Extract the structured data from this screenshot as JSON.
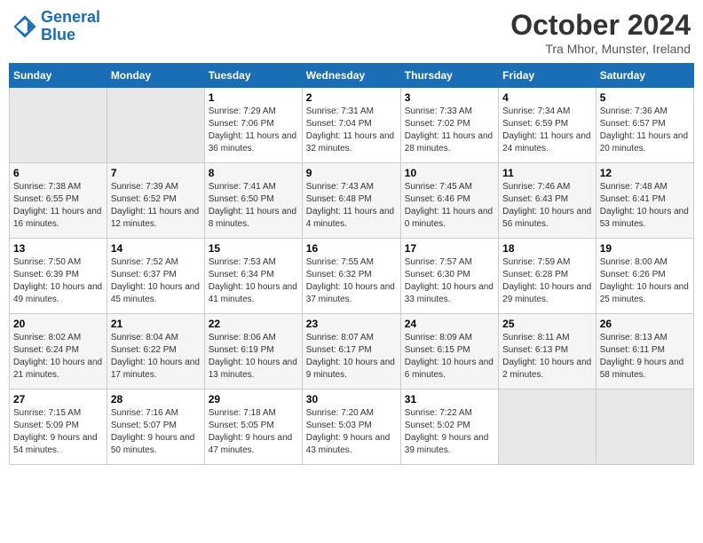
{
  "header": {
    "logo_line1": "General",
    "logo_line2": "Blue",
    "month": "October 2024",
    "location": "Tra Mhor, Munster, Ireland"
  },
  "days_of_week": [
    "Sunday",
    "Monday",
    "Tuesday",
    "Wednesday",
    "Thursday",
    "Friday",
    "Saturday"
  ],
  "weeks": [
    [
      {
        "num": "",
        "sunrise": "",
        "sunset": "",
        "daylight": ""
      },
      {
        "num": "",
        "sunrise": "",
        "sunset": "",
        "daylight": ""
      },
      {
        "num": "1",
        "sunrise": "Sunrise: 7:29 AM",
        "sunset": "Sunset: 7:06 PM",
        "daylight": "Daylight: 11 hours and 36 minutes."
      },
      {
        "num": "2",
        "sunrise": "Sunrise: 7:31 AM",
        "sunset": "Sunset: 7:04 PM",
        "daylight": "Daylight: 11 hours and 32 minutes."
      },
      {
        "num": "3",
        "sunrise": "Sunrise: 7:33 AM",
        "sunset": "Sunset: 7:02 PM",
        "daylight": "Daylight: 11 hours and 28 minutes."
      },
      {
        "num": "4",
        "sunrise": "Sunrise: 7:34 AM",
        "sunset": "Sunset: 6:59 PM",
        "daylight": "Daylight: 11 hours and 24 minutes."
      },
      {
        "num": "5",
        "sunrise": "Sunrise: 7:36 AM",
        "sunset": "Sunset: 6:57 PM",
        "daylight": "Daylight: 11 hours and 20 minutes."
      }
    ],
    [
      {
        "num": "6",
        "sunrise": "Sunrise: 7:38 AM",
        "sunset": "Sunset: 6:55 PM",
        "daylight": "Daylight: 11 hours and 16 minutes."
      },
      {
        "num": "7",
        "sunrise": "Sunrise: 7:39 AM",
        "sunset": "Sunset: 6:52 PM",
        "daylight": "Daylight: 11 hours and 12 minutes."
      },
      {
        "num": "8",
        "sunrise": "Sunrise: 7:41 AM",
        "sunset": "Sunset: 6:50 PM",
        "daylight": "Daylight: 11 hours and 8 minutes."
      },
      {
        "num": "9",
        "sunrise": "Sunrise: 7:43 AM",
        "sunset": "Sunset: 6:48 PM",
        "daylight": "Daylight: 11 hours and 4 minutes."
      },
      {
        "num": "10",
        "sunrise": "Sunrise: 7:45 AM",
        "sunset": "Sunset: 6:46 PM",
        "daylight": "Daylight: 11 hours and 0 minutes."
      },
      {
        "num": "11",
        "sunrise": "Sunrise: 7:46 AM",
        "sunset": "Sunset: 6:43 PM",
        "daylight": "Daylight: 10 hours and 56 minutes."
      },
      {
        "num": "12",
        "sunrise": "Sunrise: 7:48 AM",
        "sunset": "Sunset: 6:41 PM",
        "daylight": "Daylight: 10 hours and 53 minutes."
      }
    ],
    [
      {
        "num": "13",
        "sunrise": "Sunrise: 7:50 AM",
        "sunset": "Sunset: 6:39 PM",
        "daylight": "Daylight: 10 hours and 49 minutes."
      },
      {
        "num": "14",
        "sunrise": "Sunrise: 7:52 AM",
        "sunset": "Sunset: 6:37 PM",
        "daylight": "Daylight: 10 hours and 45 minutes."
      },
      {
        "num": "15",
        "sunrise": "Sunrise: 7:53 AM",
        "sunset": "Sunset: 6:34 PM",
        "daylight": "Daylight: 10 hours and 41 minutes."
      },
      {
        "num": "16",
        "sunrise": "Sunrise: 7:55 AM",
        "sunset": "Sunset: 6:32 PM",
        "daylight": "Daylight: 10 hours and 37 minutes."
      },
      {
        "num": "17",
        "sunrise": "Sunrise: 7:57 AM",
        "sunset": "Sunset: 6:30 PM",
        "daylight": "Daylight: 10 hours and 33 minutes."
      },
      {
        "num": "18",
        "sunrise": "Sunrise: 7:59 AM",
        "sunset": "Sunset: 6:28 PM",
        "daylight": "Daylight: 10 hours and 29 minutes."
      },
      {
        "num": "19",
        "sunrise": "Sunrise: 8:00 AM",
        "sunset": "Sunset: 6:26 PM",
        "daylight": "Daylight: 10 hours and 25 minutes."
      }
    ],
    [
      {
        "num": "20",
        "sunrise": "Sunrise: 8:02 AM",
        "sunset": "Sunset: 6:24 PM",
        "daylight": "Daylight: 10 hours and 21 minutes."
      },
      {
        "num": "21",
        "sunrise": "Sunrise: 8:04 AM",
        "sunset": "Sunset: 6:22 PM",
        "daylight": "Daylight: 10 hours and 17 minutes."
      },
      {
        "num": "22",
        "sunrise": "Sunrise: 8:06 AM",
        "sunset": "Sunset: 6:19 PM",
        "daylight": "Daylight: 10 hours and 13 minutes."
      },
      {
        "num": "23",
        "sunrise": "Sunrise: 8:07 AM",
        "sunset": "Sunset: 6:17 PM",
        "daylight": "Daylight: 10 hours and 9 minutes."
      },
      {
        "num": "24",
        "sunrise": "Sunrise: 8:09 AM",
        "sunset": "Sunset: 6:15 PM",
        "daylight": "Daylight: 10 hours and 6 minutes."
      },
      {
        "num": "25",
        "sunrise": "Sunrise: 8:11 AM",
        "sunset": "Sunset: 6:13 PM",
        "daylight": "Daylight: 10 hours and 2 minutes."
      },
      {
        "num": "26",
        "sunrise": "Sunrise: 8:13 AM",
        "sunset": "Sunset: 6:11 PM",
        "daylight": "Daylight: 9 hours and 58 minutes."
      }
    ],
    [
      {
        "num": "27",
        "sunrise": "Sunrise: 7:15 AM",
        "sunset": "Sunset: 5:09 PM",
        "daylight": "Daylight: 9 hours and 54 minutes."
      },
      {
        "num": "28",
        "sunrise": "Sunrise: 7:16 AM",
        "sunset": "Sunset: 5:07 PM",
        "daylight": "Daylight: 9 hours and 50 minutes."
      },
      {
        "num": "29",
        "sunrise": "Sunrise: 7:18 AM",
        "sunset": "Sunset: 5:05 PM",
        "daylight": "Daylight: 9 hours and 47 minutes."
      },
      {
        "num": "30",
        "sunrise": "Sunrise: 7:20 AM",
        "sunset": "Sunset: 5:03 PM",
        "daylight": "Daylight: 9 hours and 43 minutes."
      },
      {
        "num": "31",
        "sunrise": "Sunrise: 7:22 AM",
        "sunset": "Sunset: 5:02 PM",
        "daylight": "Daylight: 9 hours and 39 minutes."
      },
      {
        "num": "",
        "sunrise": "",
        "sunset": "",
        "daylight": ""
      },
      {
        "num": "",
        "sunrise": "",
        "sunset": "",
        "daylight": ""
      }
    ]
  ]
}
